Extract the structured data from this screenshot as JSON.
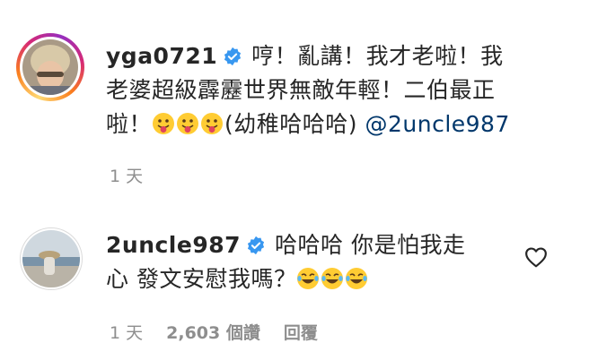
{
  "comments": [
    {
      "username": "yga0721",
      "line1": "哼！亂講！我才老啦！我",
      "line2": "老婆超級霹靂世界無敵年輕！二伯最正",
      "line3_prefix": "啦！",
      "line3_emoji_count": 3,
      "line3_suffix": "(幼稚哈哈哈)",
      "mention": "@2uncle987",
      "time": "1 天"
    },
    {
      "username": "2uncle987",
      "line1": "哈哈哈 你是怕我走",
      "line2_prefix": "心 發文安慰我嗎？",
      "line2_emoji_count": 3,
      "time": "1 天",
      "likes": "2,603 個讚",
      "reply": "回覆"
    }
  ],
  "colors": {
    "text": "#262626",
    "meta": "#8e8e8e",
    "verified": "#3897f0",
    "mention": "#00376b"
  },
  "icons": [
    "verified-badge-icon",
    "tongue-emoji-icon",
    "laughing-emoji-icon",
    "heart-icon"
  ]
}
